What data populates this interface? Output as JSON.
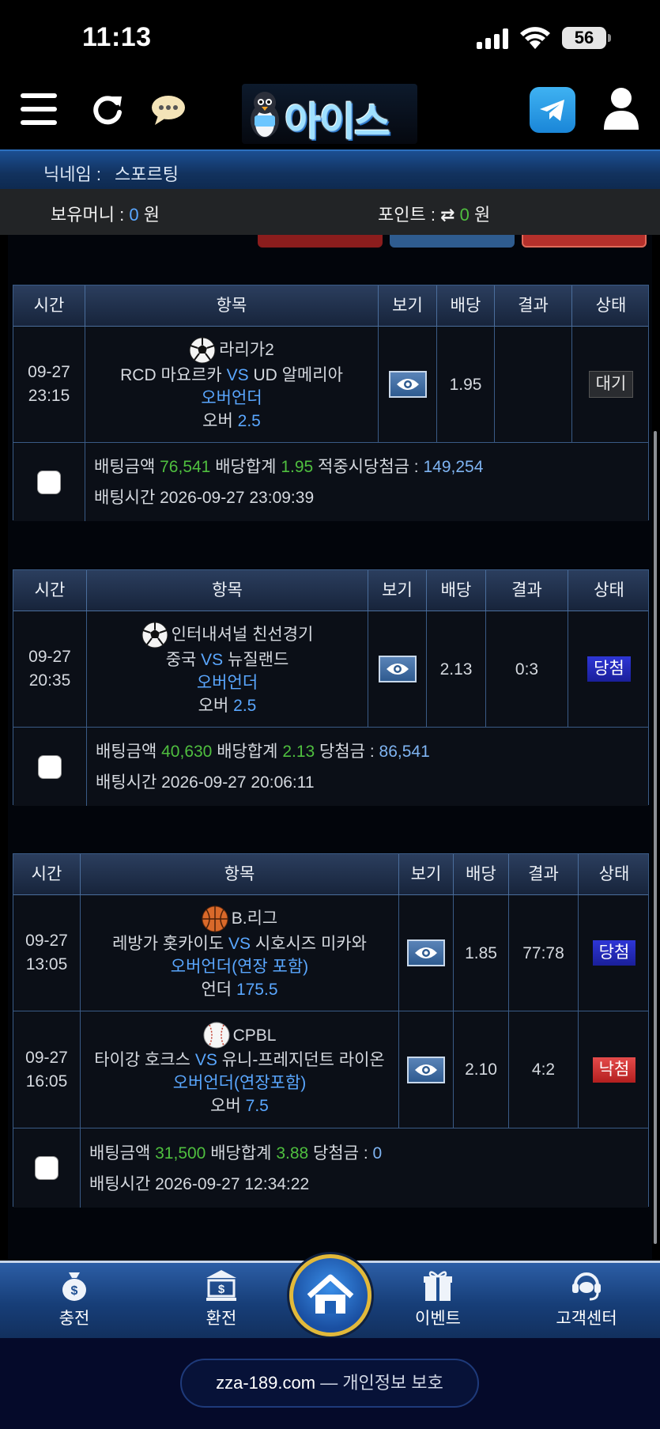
{
  "status_bar": {
    "time": "11:13",
    "battery": "56"
  },
  "header": {
    "logo_text": "아이스"
  },
  "nickname": {
    "label": "닉네임 :",
    "value": "스포르팅"
  },
  "balance": {
    "money_label": "보유머니 :",
    "money_value": "0",
    "money_unit": "원",
    "point_label": "포인트 :",
    "point_value": "0",
    "point_unit": "원"
  },
  "table_headers": {
    "time": "시간",
    "item": "항목",
    "view": "보기",
    "odds": "배당",
    "result": "결과",
    "status": "상태"
  },
  "bets": [
    {
      "selections": [
        {
          "date": "09-27",
          "time": "23:15",
          "sport_icon": "soccer-ball-icon",
          "league": "라리가2",
          "home": "RCD 마요르카",
          "vs": "VS",
          "away": "UD 알메리아",
          "market": "오버언더",
          "pick_label": "오버",
          "pick_value": "2.5",
          "odds": "1.95",
          "result": "",
          "status": "대기"
        }
      ],
      "summary": {
        "amount_label": "배팅금액",
        "amount": "76,541",
        "total_odds_label": "배당합계",
        "total_odds": "1.95",
        "payout_label": "적중시당첨금 :",
        "payout": "149,254",
        "time_label": "배팅시간",
        "bet_time": "2026-09-27 23:09:39"
      }
    },
    {
      "selections": [
        {
          "date": "09-27",
          "time": "20:35",
          "sport_icon": "soccer-ball-icon",
          "league": "인터내셔널 친선경기",
          "home": "중국",
          "vs": "VS",
          "away": "뉴질랜드",
          "market": "오버언더",
          "pick_label": "오버",
          "pick_value": "2.5",
          "odds": "2.13",
          "result": "0:3",
          "status": "당첨"
        }
      ],
      "summary": {
        "amount_label": "배팅금액",
        "amount": "40,630",
        "total_odds_label": "배당합계",
        "total_odds": "2.13",
        "payout_label": "당첨금 :",
        "payout": "86,541",
        "time_label": "배팅시간",
        "bet_time": "2026-09-27 20:06:11"
      }
    },
    {
      "selections": [
        {
          "date": "09-27",
          "time": "13:05",
          "sport_icon": "basketball-icon",
          "league": "B.리그",
          "home": "레방가 홋카이도",
          "vs": "VS",
          "away": "시호시즈 미카와",
          "market": "오버언더(연장 포함)",
          "pick_label": "언더",
          "pick_value": "175.5",
          "odds": "1.85",
          "result": "77:78",
          "status": "당첨"
        },
        {
          "date": "09-27",
          "time": "16:05",
          "sport_icon": "baseball-icon",
          "league": "CPBL",
          "home": "타이강 호크스",
          "vs": "VS",
          "away": "유니-프레지던트 라이온",
          "market": "오버언더(연장포함)",
          "pick_label": "오버",
          "pick_value": "7.5",
          "odds": "2.10",
          "result": "4:2",
          "status": "낙첨"
        }
      ],
      "summary": {
        "amount_label": "배팅금액",
        "amount": "31,500",
        "total_odds_label": "배당합계",
        "total_odds": "3.88",
        "payout_label": "당첨금 :",
        "payout": "0",
        "time_label": "배팅시간",
        "bet_time": "2026-09-27 12:34:22"
      }
    }
  ],
  "bottom_nav": {
    "charge": "충전",
    "exchange": "환전",
    "event": "이벤트",
    "support": "고객센터"
  },
  "footer": {
    "domain": "zza-189.com",
    "separator": "—",
    "privacy": "개인정보 보호"
  },
  "colors": {
    "accent_blue": "#5aa7ff",
    "green": "#4fbf3f",
    "win": "#2e36d6",
    "lose": "#e44b4b"
  }
}
